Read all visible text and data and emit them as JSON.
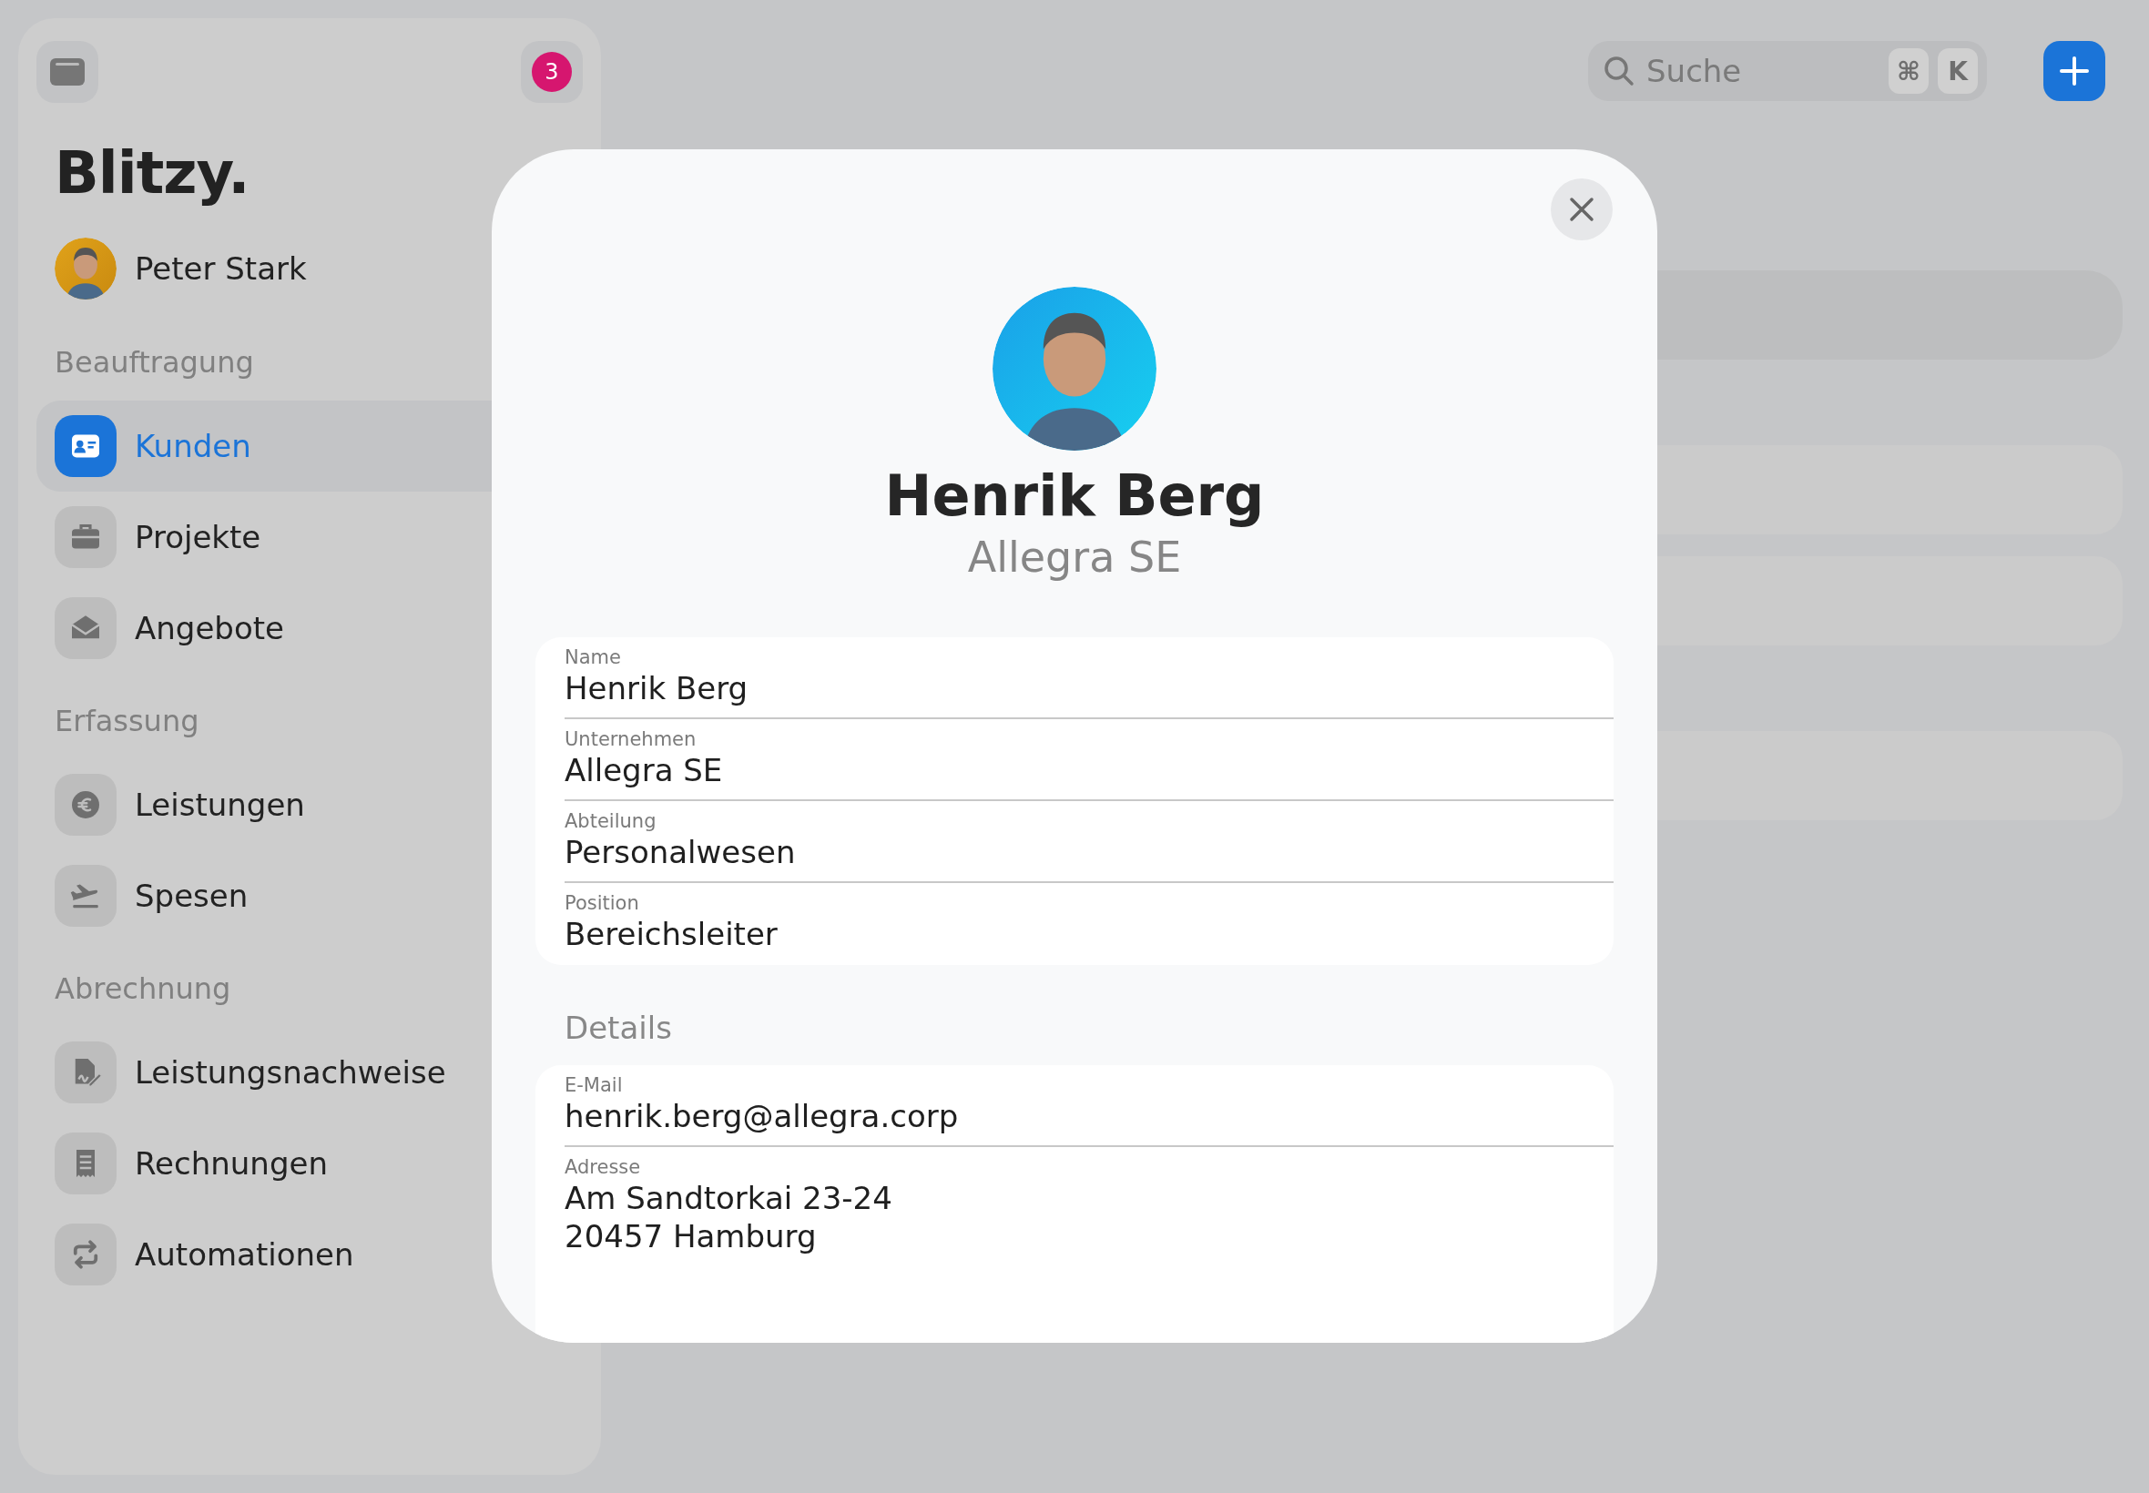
{
  "sidebar": {
    "notification_count": "3",
    "logo": "Blitzy.",
    "user": {
      "name": "Peter Stark"
    },
    "sections": [
      {
        "title": "Beauftragung",
        "items": [
          {
            "label": "Kunden",
            "selected": true
          },
          {
            "label": "Projekte",
            "selected": false
          },
          {
            "label": "Angebote",
            "selected": false
          }
        ]
      },
      {
        "title": "Erfassung",
        "items": [
          {
            "label": "Leistungen",
            "selected": false
          },
          {
            "label": "Spesen",
            "selected": false
          }
        ]
      },
      {
        "title": "Abrechnung",
        "items": [
          {
            "label": "Leistungsnachweise",
            "selected": false
          },
          {
            "label": "Rechnungen",
            "selected": false
          },
          {
            "label": "Automationen",
            "selected": false
          }
        ]
      }
    ]
  },
  "toolbar": {
    "search": {
      "placeholder": "Suche",
      "shortcut_keys": [
        "⌘",
        "K"
      ]
    }
  },
  "contact_dialog": {
    "name": "Henrik Berg",
    "company": "Allegra SE",
    "fields": [
      {
        "label": "Name",
        "value": "Henrik Berg"
      },
      {
        "label": "Unternehmen",
        "value": "Allegra SE"
      },
      {
        "label": "Abteilung",
        "value": "Personalwesen"
      },
      {
        "label": "Position",
        "value": "Bereichsleiter"
      }
    ],
    "details_title": "Details",
    "details": [
      {
        "label": "E-Mail",
        "value": "henrik.berg@allegra.corp"
      },
      {
        "label": "Adresse",
        "value": "Am Sandtorkai 23-24\n20457 Hamburg"
      }
    ]
  }
}
